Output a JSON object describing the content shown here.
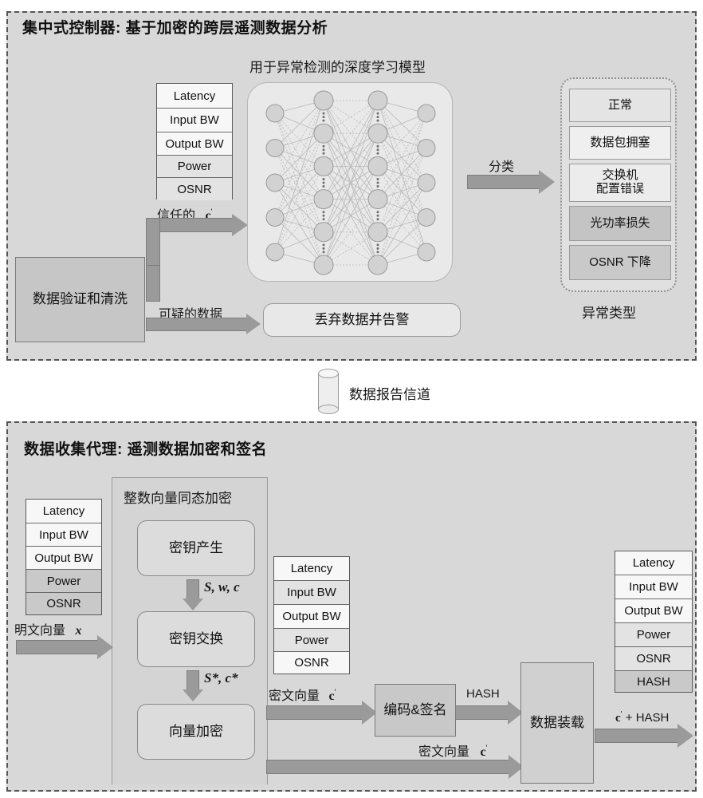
{
  "top_panel": {
    "title_prefix": "集中式控制器",
    "title_sep": ": ",
    "title_main": "基于加密的跨层遥测数据分析",
    "nn_caption": "用于异常检测的深度学习模型",
    "metrics_box": {
      "rows": [
        "Latency",
        "Input BW",
        "Output BW",
        "Power",
        "OSNR"
      ]
    },
    "trusted_label_cn": "信任的",
    "trusted_label_sym": "c",
    "trusted_label_sup": "'",
    "validation_box": "数据验证和清洗",
    "suspicious_label": "可疑的数据",
    "discard_box": "丢弃数据并告警",
    "classify_label": "分类",
    "anomaly_caption": "异常类型",
    "anomaly_items": [
      "正常",
      "数据包拥塞",
      "交换机\n配置错误",
      "光功率损失",
      "OSNR 下降"
    ]
  },
  "channel": {
    "label": "数据报告信道",
    "icon": "cylinder-icon"
  },
  "bottom_panel": {
    "title_prefix": "数据收集代理",
    "title_sep": ": ",
    "title_main": "遥测数据加密和签名",
    "left_metrics": {
      "rows": [
        "Latency",
        "Input BW",
        "Output BW",
        "Power",
        "OSNR"
      ]
    },
    "plaintext_label_cn": "明文向量",
    "plaintext_label_sym": "x",
    "he_group_title": "整数向量同态加密",
    "he_steps": [
      "密钥产生",
      "密钥交换",
      "向量加密"
    ],
    "he_arrow_labels": [
      "S, w, c",
      "S*, c*"
    ],
    "mid_metrics": {
      "rows": [
        "Latency",
        "Input BW",
        "Output BW",
        "Power",
        "OSNR"
      ]
    },
    "cipher_label_1_cn": "密文向量",
    "cipher_label_1_sym": "c",
    "encode_sign_box": "编码&签名",
    "hash_label": "HASH",
    "cipher_label_2_cn": "密文向量",
    "cipher_label_2_sym": "c",
    "payload_box": "数据装载",
    "right_metrics": {
      "rows": [
        "Latency",
        "Input BW",
        "Output BW",
        "Power",
        "OSNR",
        "HASH"
      ]
    },
    "output_label_sym": "c",
    "output_label_rest": " + HASH"
  },
  "colors": {
    "panel_bg": "#d8d8d8",
    "panel_border": "#555555",
    "arrow": "#9a9a9a",
    "box_fill": "#dcdcdc",
    "shade_light": "#f7f7f7",
    "shade_mid": "#e3e3e3",
    "shade_dark": "#c9c9c9"
  },
  "chart_data": {
    "type": "diagram",
    "title": "基于加密的跨层遥测数据分析架构",
    "network": {
      "layers": [
        5,
        6,
        6,
        5
      ],
      "layer_has_ellipsis": [
        false,
        true,
        true,
        false
      ]
    }
  }
}
